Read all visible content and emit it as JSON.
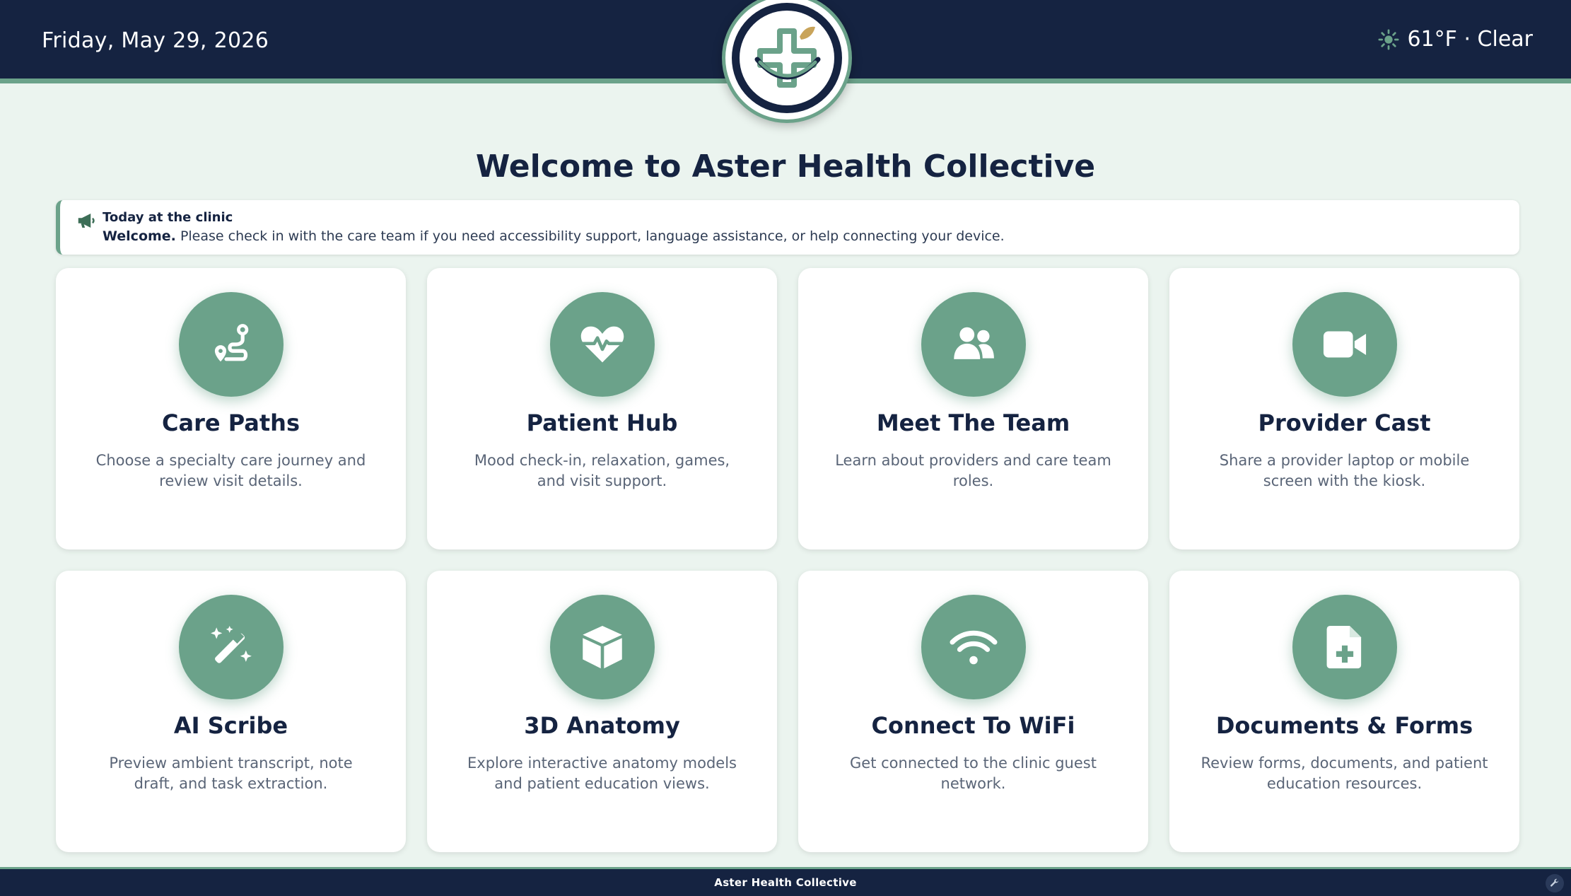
{
  "header": {
    "date": "Friday, May 29, 2026",
    "weather": "61°F · Clear",
    "weather_icon": "sun-icon"
  },
  "logo": {
    "icon": "medical-cross-leaf-logo"
  },
  "welcome_title": "Welcome to Aster Health Collective",
  "notice": {
    "icon": "megaphone-icon",
    "title": "Today at the clinic",
    "lead": "Welcome.",
    "text": " Please check in with the care team if you need accessibility support, language assistance, or help connecting your device."
  },
  "cards": [
    {
      "title": "Care Paths",
      "desc": "Choose a specialty care journey and review visit details.",
      "icon": "route-icon"
    },
    {
      "title": "Patient Hub",
      "desc": "Mood check-in, relaxation, games, and visit support.",
      "icon": "heart-pulse-icon"
    },
    {
      "title": "Meet The Team",
      "desc": "Learn about providers and care team roles.",
      "icon": "users-icon"
    },
    {
      "title": "Provider Cast",
      "desc": "Share a provider laptop or mobile screen with the kiosk.",
      "icon": "video-camera-icon"
    },
    {
      "title": "AI Scribe",
      "desc": "Preview ambient transcript, note draft, and task extraction.",
      "icon": "magic-wand-icon"
    },
    {
      "title": "3D Anatomy",
      "desc": "Explore interactive anatomy models and patient education views.",
      "icon": "cube-icon"
    },
    {
      "title": "Connect To WiFi",
      "desc": "Get connected to the clinic guest network.",
      "icon": "wifi-icon"
    },
    {
      "title": "Documents & Forms",
      "desc": "Review forms, documents, and patient education resources.",
      "icon": "file-medical-icon"
    }
  ],
  "footer": {
    "text": "Aster Health Collective",
    "tool_icon": "wrench-icon"
  },
  "colors": {
    "navy": "#152341",
    "sage": "#6ba28a",
    "background": "#ebf4ef"
  }
}
